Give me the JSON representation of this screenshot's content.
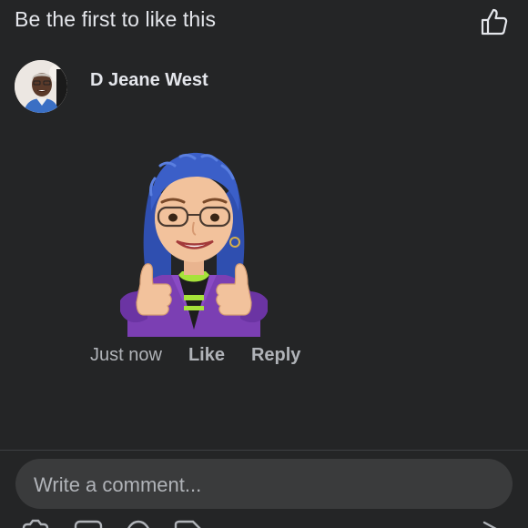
{
  "likes": {
    "status_text": "Be the first to like this"
  },
  "comment": {
    "author": "D Jeane West",
    "timestamp": "Just now",
    "actions": {
      "like": "Like",
      "reply": "Reply"
    }
  },
  "composer": {
    "placeholder": "Write a comment..."
  },
  "colors": {
    "background": "#242526",
    "primary_text": "#e4e6eb",
    "secondary_text": "#b0b3b8",
    "input_background": "#3a3b3c"
  },
  "icons": {
    "like_button": "thumbs-up-icon",
    "bottom_toolbar": [
      "camera-icon",
      "gif-icon",
      "emoji-icon",
      "sticker-icon",
      "send-icon"
    ]
  }
}
